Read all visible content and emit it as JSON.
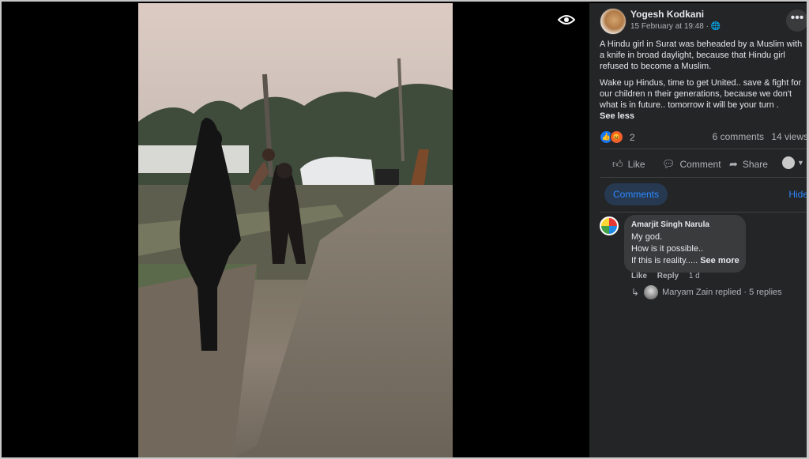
{
  "post": {
    "author": "Yogesh Kodkani",
    "date": "15 February at 19:48",
    "privacy_icon": "globe-icon",
    "more_label": "•••",
    "text_paragraph_1": "A Hindu girl in Surat was beheaded by a Muslim with a knife in broad daylight, because that Hindu girl refused to become a Muslim.",
    "text_paragraph_2": "Wake up Hindus, time to get United.. save & fight for our children n their generations, because we don't what is in future.. tomorrow it will be your turn .",
    "see_less": "See less"
  },
  "reactions": {
    "icons": [
      "like-icon",
      "angry-icon"
    ],
    "count": "2",
    "comments": "6 comments",
    "views": "14 views"
  },
  "actions": {
    "like": "Like",
    "comment": "Comment",
    "share": "Share"
  },
  "comments_section": {
    "tab_label": "Comments",
    "hide_label": "Hide"
  },
  "comment": {
    "author": "Amarjit Singh Narula",
    "line_1": "My god.",
    "line_2": "How is it possible..",
    "line_3": "If this is reality.....",
    "see_more": "See more",
    "like": "Like",
    "reply": "Reply",
    "time": "1 d",
    "replies_text": "Maryam Zain replied · 5 replies"
  }
}
